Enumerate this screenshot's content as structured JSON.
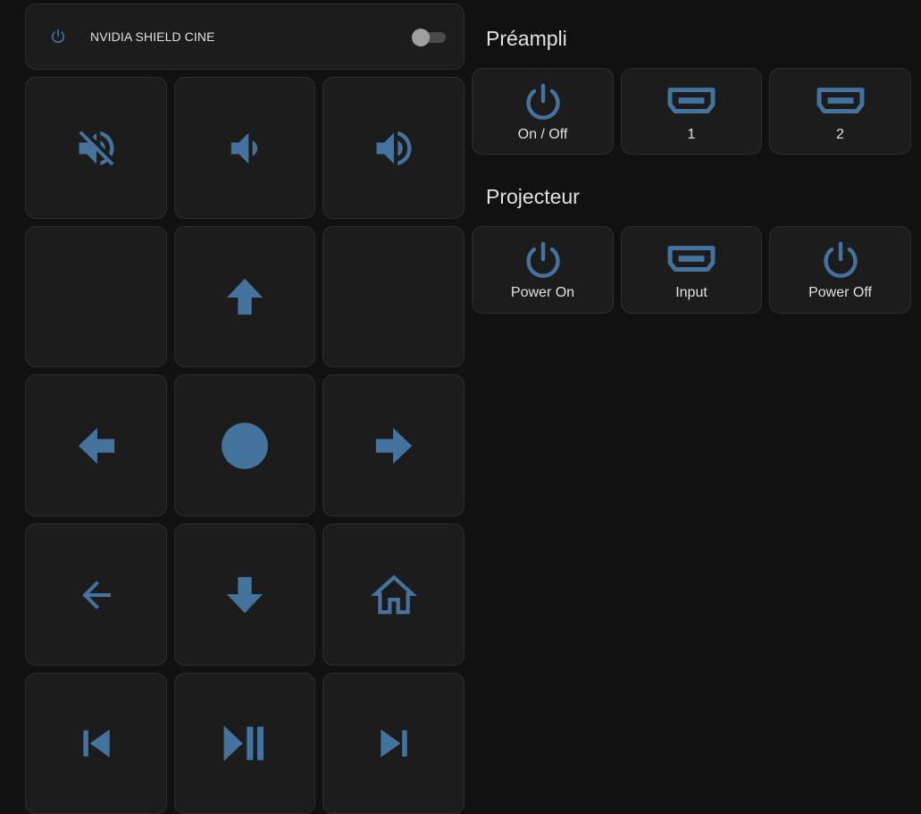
{
  "media_player": {
    "name": "NVIDIA SHIELD CINE",
    "power_icon": "power-icon",
    "toggle_state": "off"
  },
  "remote": {
    "icons": {
      "mute": "volume-mute-icon",
      "volume_down": "volume-down-icon",
      "volume_up": "volume-up-icon",
      "up": "arrow-up-icon",
      "left": "arrow-left-icon",
      "select": "select-circle-icon",
      "right": "arrow-right-icon",
      "back": "back-arrow-icon",
      "down": "arrow-down-icon",
      "home": "home-icon",
      "previous": "skip-previous-icon",
      "play_pause": "play-pause-icon",
      "next": "skip-next-icon"
    }
  },
  "preampli": {
    "title": "Préampli",
    "buttons": [
      {
        "label": "On / Off",
        "icon": "power-icon"
      },
      {
        "label": "1",
        "icon": "hdmi-port-icon"
      },
      {
        "label": "2",
        "icon": "hdmi-port-icon"
      }
    ]
  },
  "projecteur": {
    "title": "Projecteur",
    "buttons": [
      {
        "label": "Power On",
        "icon": "power-icon"
      },
      {
        "label": "Input",
        "icon": "hdmi-port-icon"
      },
      {
        "label": "Power Off",
        "icon": "power-icon"
      }
    ]
  },
  "colors": {
    "icon_blue": "#44739e",
    "background": "#111111",
    "card": "#1c1c1c",
    "text": "#e1e1e1"
  }
}
